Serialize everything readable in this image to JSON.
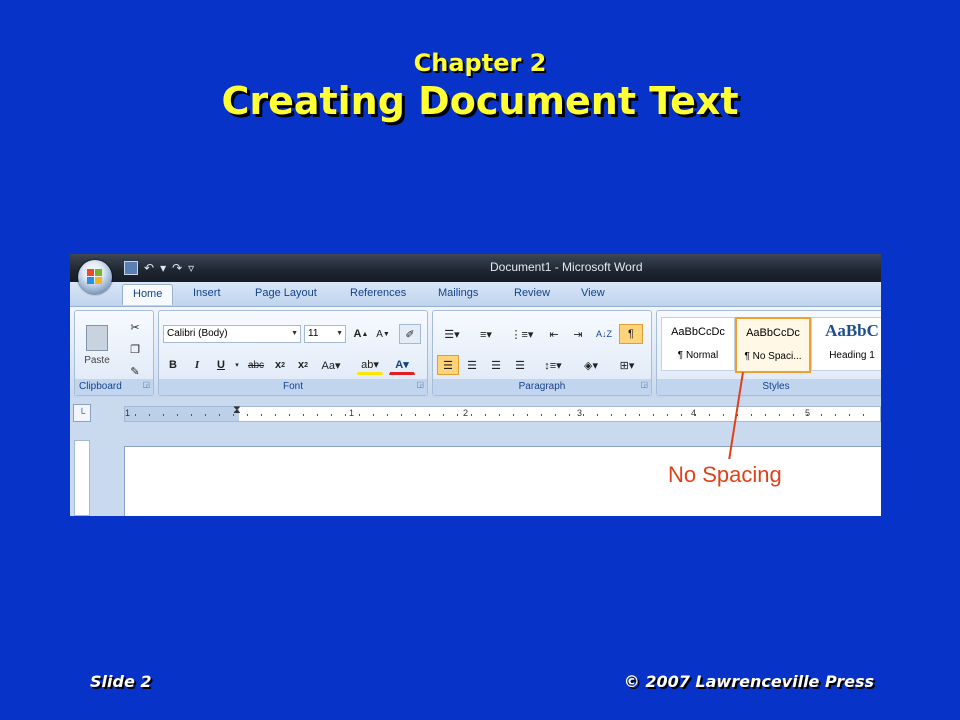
{
  "slide": {
    "subtitle": "Chapter 2",
    "title": "Creating Document Text",
    "footer_left": "Slide 2",
    "footer_right": "© 2007 Lawrenceville Press"
  },
  "word": {
    "window_title": "Document1 - Microsoft Word",
    "tabs": [
      "Home",
      "Insert",
      "Page Layout",
      "References",
      "Mailings",
      "Review",
      "View"
    ],
    "groups": {
      "clipboard": "Clipboard",
      "font": "Font",
      "paragraph": "Paragraph",
      "styles": "Styles"
    },
    "paste_label": "Paste",
    "font_name": "Calibri (Body)",
    "font_size": "11",
    "styles": [
      {
        "preview": "AaBbCcDc",
        "name": "¶ Normal"
      },
      {
        "preview": "AaBbCcDc",
        "name": "¶ No Spaci..."
      },
      {
        "preview": "AaBbC",
        "name": "Heading 1"
      }
    ],
    "ruler_numbers": [
      "1",
      "1",
      "2",
      "3",
      "4",
      "5"
    ],
    "callout": "No Spacing"
  },
  "colors": {
    "background": "#0733c8",
    "title": "#ffff33",
    "callout": "#e0401a",
    "selected_style_border": "#f0a030"
  }
}
